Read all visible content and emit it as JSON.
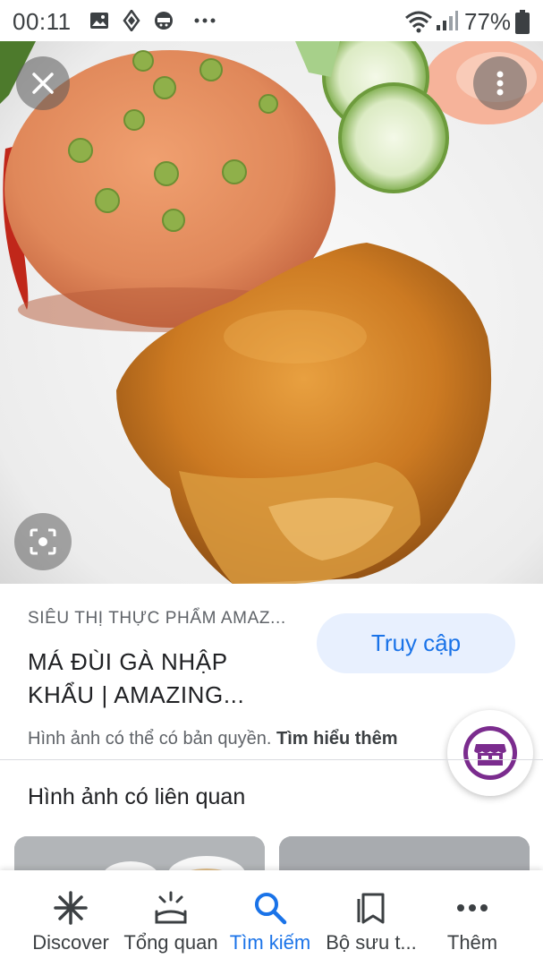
{
  "status_bar": {
    "time": "00:11",
    "battery": "77%"
  },
  "source": "SIÊU THỊ THỰC PHẨM AMAZ...",
  "title": {
    "line1": "MÁ ĐÙI GÀ NHẬP",
    "line2": "KHẨU  |  AMAZING..."
  },
  "visit_button": "Truy cập",
  "copyright": {
    "text": "Hình ảnh có thể có bản quyền.",
    "link": "Tìm hiểu thêm"
  },
  "related_title": "Hình ảnh có liên quan",
  "nav": {
    "items": [
      {
        "label": "Discover",
        "icon": "asterisk-icon"
      },
      {
        "label": "Tổng quan",
        "icon": "updates-icon"
      },
      {
        "label": "Tìm kiếm",
        "icon": "search-icon"
      },
      {
        "label": "Bộ sưu t...",
        "icon": "collections-icon"
      },
      {
        "label": "Thêm",
        "icon": "more-icon"
      }
    ],
    "active_index": 2,
    "active_color": "#1a73e8"
  }
}
